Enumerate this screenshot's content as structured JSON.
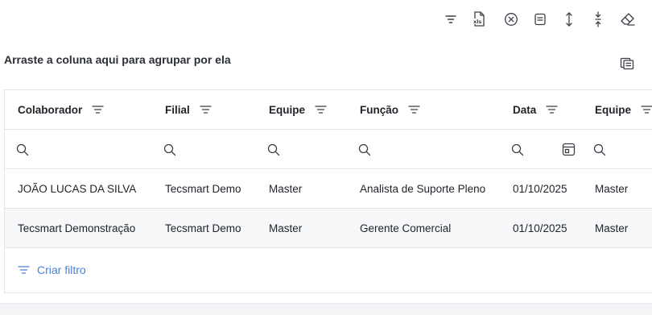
{
  "toolbar": {
    "icons": [
      "filter-icon",
      "export-xls-icon",
      "clear-filter-icon",
      "summary-icon",
      "expand-rows-icon",
      "collapse-rows-icon",
      "eraser-icon"
    ],
    "xls_label": "xls"
  },
  "group_panel": {
    "text": "Arraste a coluna aqui para agrupar por ela"
  },
  "columns": [
    {
      "label": "Colaborador"
    },
    {
      "label": "Filial"
    },
    {
      "label": "Equipe"
    },
    {
      "label": "Função"
    },
    {
      "label": "Data"
    },
    {
      "label": "Equipe"
    }
  ],
  "rows": [
    [
      "JOÃO LUCAS DA SILVA",
      "Tecsmart Demo",
      "Master",
      "Analista de Suporte Pleno",
      "01/10/2025",
      "Master"
    ],
    [
      "Tecsmart Demonstração",
      "Tecsmart Demo",
      "Master",
      "Gerente Comercial",
      "01/10/2025",
      "Master"
    ]
  ],
  "footer": {
    "create_filter_label": "Criar filtro"
  },
  "colors": {
    "accent": "#4a7fd8",
    "border": "#e3e5e8",
    "alt_row": "#f6f7f9"
  }
}
